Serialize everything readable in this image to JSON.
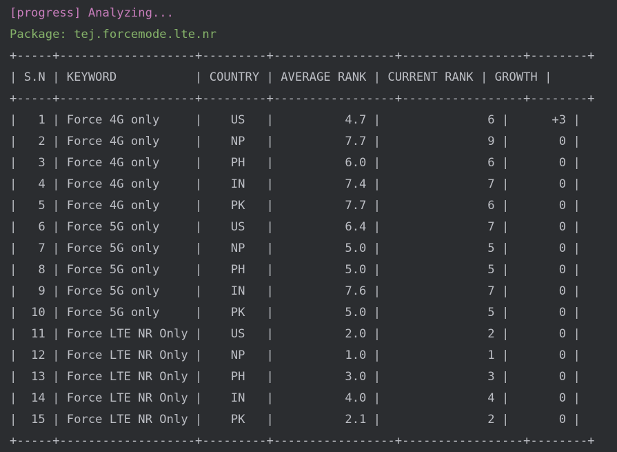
{
  "progress_line": "[progress] Analyzing...",
  "package_line": "Package: tej.forcemode.lte.nr",
  "colors": {
    "background": "#2b2d30",
    "text": "#bcbec4",
    "progress": "#c77dbb",
    "package": "#86b36a"
  },
  "table": {
    "border": "+-----+-------------------+---------+-----------------+-----------------+--------+",
    "header": "| S.N | KEYWORD           | COUNTRY | AVERAGE RANK | CURRENT RANK | GROWTH |",
    "rows": [
      "|   1 | Force 4G only     |    US   |          4.7 |               6 |      +3 |",
      "|   2 | Force 4G only     |    NP   |          7.7 |               9 |       0 |",
      "|   3 | Force 4G only     |    PH   |          6.0 |               6 |       0 |",
      "|   4 | Force 4G only     |    IN   |          7.4 |               7 |       0 |",
      "|   5 | Force 4G only     |    PK   |          7.7 |               6 |       0 |",
      "|   6 | Force 5G only     |    US   |          6.4 |               7 |       0 |",
      "|   7 | Force 5G only     |    NP   |          5.0 |               5 |       0 |",
      "|   8 | Force 5G only     |    PH   |          5.0 |               5 |       0 |",
      "|   9 | Force 5G only     |    IN   |          7.6 |               7 |       0 |",
      "|  10 | Force 5G only     |    PK   |          5.0 |               5 |       0 |",
      "|  11 | Force LTE NR Only |    US   |          2.0 |               2 |       0 |",
      "|  12 | Force LTE NR Only |    NP   |          1.0 |               1 |       0 |",
      "|  13 | Force LTE NR Only |    PH   |          3.0 |               3 |       0 |",
      "|  14 | Force LTE NR Only |    IN   |          4.0 |               4 |       0 |",
      "|  15 | Force LTE NR Only |    PK   |          2.1 |               2 |       0 |"
    ]
  }
}
